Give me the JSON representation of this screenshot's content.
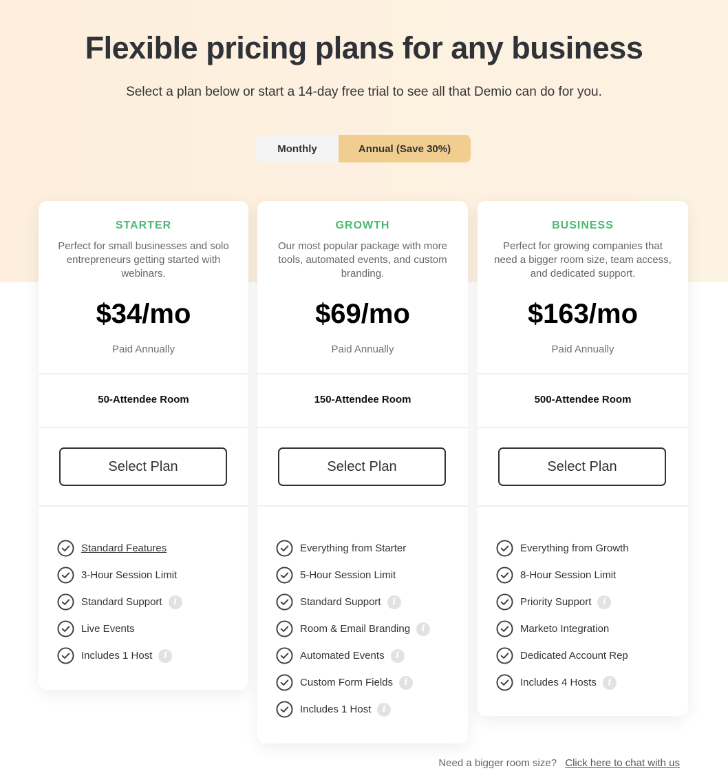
{
  "header": {
    "title": "Flexible pricing plans for any business",
    "subtitle": "Select a plan below or start a 14-day free trial to see all that Demio can do for you."
  },
  "billing_toggle": {
    "options": [
      "Monthly",
      "Annual (Save 30%)"
    ],
    "selected": "Annual (Save 30%)"
  },
  "colors": {
    "accent_green": "#4cb873",
    "toggle_active": "#f2cd90",
    "hero_background": "#fdeedd"
  },
  "plans": [
    {
      "name": "STARTER",
      "description": "Perfect for small businesses and solo entrepreneurs getting started with webinars.",
      "price": "$34/mo",
      "billing": "Paid Annually",
      "room": "50-Attendee Room",
      "cta": "Select Plan",
      "features": [
        {
          "label": "Standard Features",
          "info": false,
          "link": true
        },
        {
          "label": "3-Hour Session Limit",
          "info": false
        },
        {
          "label": "Standard Support",
          "info": true
        },
        {
          "label": "Live Events",
          "info": false
        },
        {
          "label": "Includes 1 Host",
          "info": true
        }
      ]
    },
    {
      "name": "GROWTH",
      "description": "Our most popular package with more tools, automated events, and custom branding.",
      "price": "$69/mo",
      "billing": "Paid Annually",
      "room": "150-Attendee Room",
      "cta": "Select Plan",
      "features": [
        {
          "label": "Everything from Starter",
          "info": false
        },
        {
          "label": "5-Hour Session Limit",
          "info": false
        },
        {
          "label": "Standard Support",
          "info": true
        },
        {
          "label": "Room & Email Branding",
          "info": true
        },
        {
          "label": "Automated Events",
          "info": true
        },
        {
          "label": "Custom Form Fields",
          "info": true
        },
        {
          "label": "Includes 1 Host",
          "info": true
        }
      ]
    },
    {
      "name": "BUSINESS",
      "description": "Perfect for growing companies that need a bigger room size, team access, and dedicated support.",
      "price": "$163/mo",
      "billing": "Paid Annually",
      "room": "500-Attendee Room",
      "cta": "Select Plan",
      "features": [
        {
          "label": "Everything from Growth",
          "info": false
        },
        {
          "label": "8-Hour Session Limit",
          "info": false
        },
        {
          "label": "Priority Support",
          "info": true
        },
        {
          "label": "Marketo Integration",
          "info": false
        },
        {
          "label": "Dedicated Account Rep",
          "info": false
        },
        {
          "label": "Includes 4 Hosts",
          "info": true
        }
      ]
    }
  ],
  "footer": {
    "question": "Need a bigger room size?",
    "link": "Click here to chat with us"
  }
}
